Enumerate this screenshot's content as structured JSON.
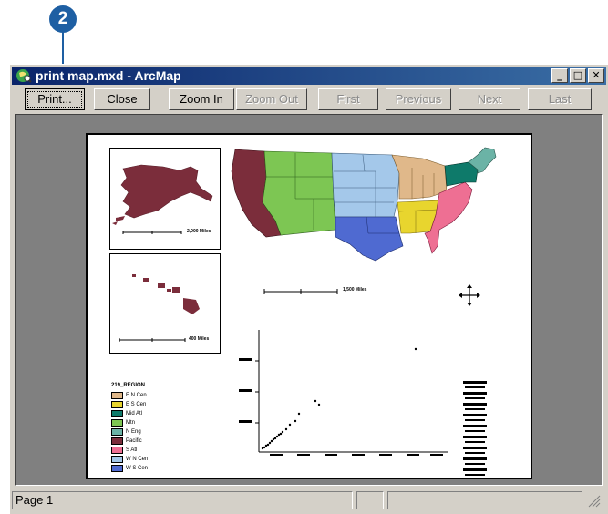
{
  "callout": {
    "number": "2"
  },
  "window": {
    "title": "print map.mxd - ArcMap"
  },
  "window_buttons": {
    "minimize": "_",
    "maximize": "□",
    "close": "✕"
  },
  "toolbar": {
    "print": "Print...",
    "close": "Close",
    "zoom_in": "Zoom In",
    "zoom_out": "Zoom Out",
    "first": "First",
    "previous": "Previous",
    "next": "Next",
    "last": "Last"
  },
  "statusbar": {
    "page": "Page 1"
  },
  "map": {
    "region_colors": {
      "Pacific": "#7b2d3b",
      "Mountain": "#7dc653",
      "W N Cen": "#a4c8ea",
      "W S Cen": "#4f6ad1",
      "E N Cen": "#e0b88a",
      "E S Cen": "#e8d52e",
      "S Atl": "#ee6f93",
      "Mid Atl": "#0e7a6a",
      "N Eng": "#6bb3a6"
    },
    "legend": {
      "title": "219_REGION",
      "items": [
        {
          "label": "E N Cen",
          "color": "#e0b88a"
        },
        {
          "label": "E S Cen",
          "color": "#e8d52e"
        },
        {
          "label": "Mid Atl",
          "color": "#0e7a6a"
        },
        {
          "label": "Mtn",
          "color": "#7dc653"
        },
        {
          "label": "N Eng",
          "color": "#6bb3a6"
        },
        {
          "label": "Pacific",
          "color": "#7b2d3b"
        },
        {
          "label": "S Atl",
          "color": "#ee6f93"
        },
        {
          "label": "W N Cen",
          "color": "#a4c8ea"
        },
        {
          "label": "W S Cen",
          "color": "#4f6ad1"
        }
      ]
    },
    "scale_labels": {
      "alaska": "2,000 Miles",
      "hawaii": "400 Miles",
      "main": "1,500 Miles"
    }
  }
}
